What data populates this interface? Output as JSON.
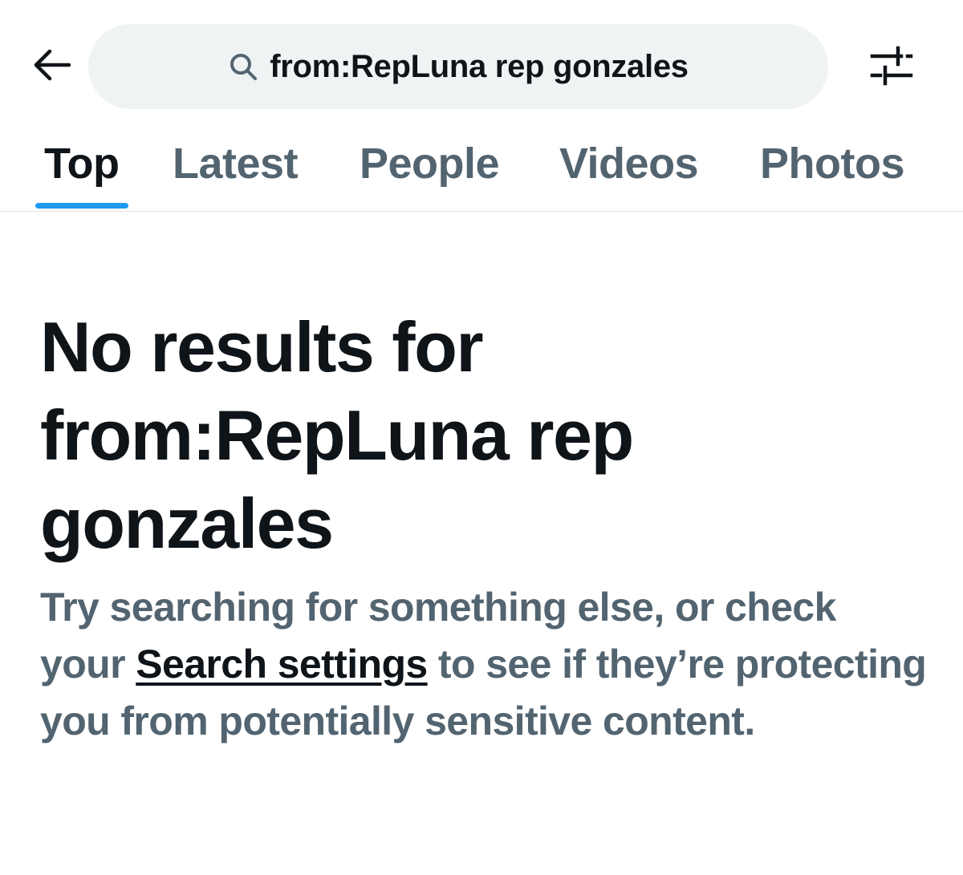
{
  "header": {
    "back_icon": "arrow-left-icon",
    "search": {
      "icon": "search-icon",
      "query": "from:RepLuna rep gonzales"
    },
    "filter_icon": "sliders-icon"
  },
  "tabs": [
    {
      "label": "Top",
      "active": true
    },
    {
      "label": "Latest",
      "active": false
    },
    {
      "label": "People",
      "active": false
    },
    {
      "label": "Videos",
      "active": false
    },
    {
      "label": "Photos",
      "active": false
    }
  ],
  "empty_state": {
    "title": "No results for from:RepLuna rep gonzales",
    "desc_before": "Try searching for something else, or check your ",
    "link_text": "Search settings",
    "desc_after": " to see if they’re protecting you from potentially sensitive content."
  },
  "colors": {
    "accent": "#1d9bf0",
    "text_primary": "#0f1419",
    "text_secondary": "#536471",
    "search_bg": "#eff3f4"
  }
}
